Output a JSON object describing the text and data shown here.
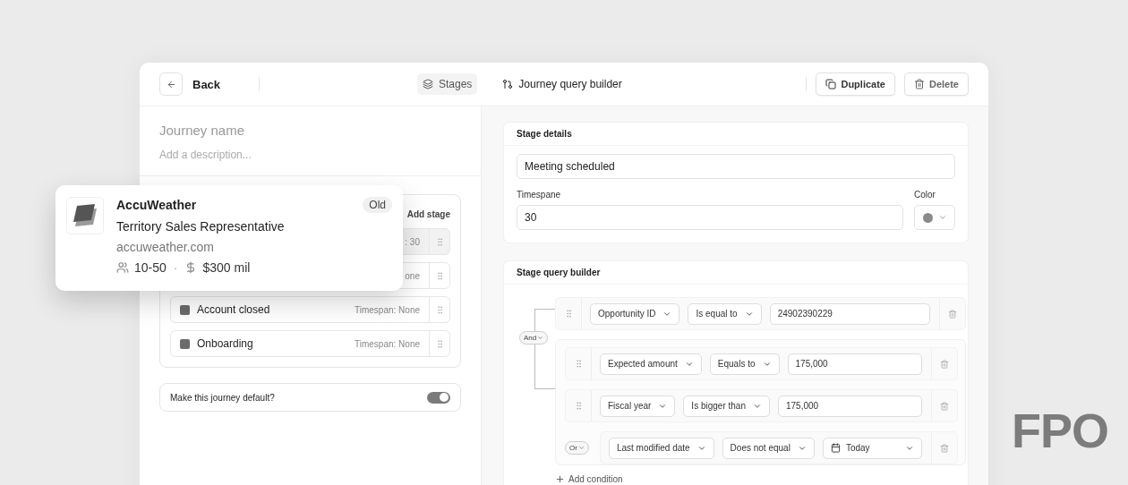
{
  "header": {
    "back": "Back",
    "tabs": [
      {
        "label": "Stages",
        "kind": "stages",
        "selected": true
      },
      {
        "label": "Journey query builder",
        "kind": "builder",
        "selected": false
      }
    ],
    "actions": [
      {
        "label": "Duplicate",
        "kind": "duplicate"
      },
      {
        "label": "Delete",
        "kind": "delete"
      }
    ]
  },
  "journey_name": {
    "placeholder": "Journey name"
  },
  "description": {
    "placeholder": "Add a description..."
  },
  "stages": {
    "add_label": "Add stage",
    "rows": [
      {
        "timespan": ": 30",
        "selected": true
      },
      {
        "timespan": "one",
        "selected": false
      },
      {
        "name": "Account closed",
        "timespan": "Timespan: None",
        "selected": false
      },
      {
        "name": "Onboarding",
        "timespan": "Timespan: None",
        "selected": false
      }
    ]
  },
  "default_toggle": {
    "label": "Make this journey default?",
    "on": true
  },
  "company_card": {
    "name": "AccuWeather",
    "badge": "Old",
    "title": "Territory Sales Representative",
    "domain": "accuweather.com",
    "employees": "10-50",
    "separator": "·",
    "revenue": "$300 mil"
  },
  "stage_details": {
    "title": "Stage details",
    "name_value": "Meeting scheduled",
    "timespan_label": "Timespane",
    "timespan_value": "30",
    "color_label": "Color"
  },
  "query_builder": {
    "title": "Stage query builder",
    "group": {
      "kind": "group",
      "operator": "And",
      "add_label": "Add condition",
      "children": [
        {
          "kind": "condition",
          "field": "Opportunity ID",
          "operator": "Is equal to",
          "value": "24902390229"
        },
        {
          "kind": "group",
          "children": [
            {
              "kind": "condition",
              "field": "Expected amount",
              "operator": "Equals to",
              "value": "175,000"
            },
            {
              "kind": "condition",
              "field": "Fiscal year",
              "operator": "Is bigger than",
              "value": "175,000"
            },
            {
              "kind": "group",
              "operator": "Or",
              "children": [
                {
                  "kind": "date_condition",
                  "field": "Last modified date",
                  "operator": "Does not equal",
                  "value": "Today"
                }
              ]
            }
          ]
        }
      ]
    }
  },
  "overlay_mark": "FPO"
}
